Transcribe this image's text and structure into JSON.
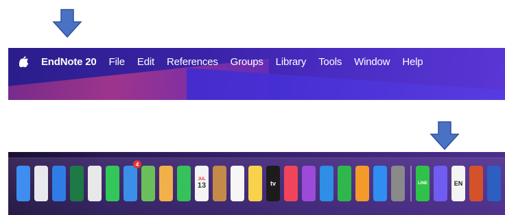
{
  "menubar": {
    "app_name": "EndNote 20",
    "items": [
      "File",
      "Edit",
      "References",
      "Groups",
      "Library",
      "Tools",
      "Window",
      "Help"
    ]
  },
  "dock": {
    "apps": [
      {
        "name": "Finder",
        "icon": "finder-icon",
        "color": "#3d8ef0"
      },
      {
        "name": "Launchpad",
        "icon": "launchpad-icon",
        "color": "#e8e8ee"
      },
      {
        "name": "Safari",
        "icon": "safari-icon",
        "color": "#2f7ce6"
      },
      {
        "name": "Excel",
        "icon": "excel-icon",
        "color": "#1e7a44"
      },
      {
        "name": "Chrome",
        "icon": "chrome-icon",
        "color": "#e8e8e8"
      },
      {
        "name": "Messages",
        "icon": "messages-icon",
        "color": "#33c75a"
      },
      {
        "name": "Mail",
        "icon": "mail-icon",
        "color": "#3b8fe8",
        "badge": "4"
      },
      {
        "name": "Maps",
        "icon": "maps-icon",
        "color": "#6bbf5a"
      },
      {
        "name": "Photos",
        "icon": "photos-icon",
        "color": "#f2b04a"
      },
      {
        "name": "FaceTime",
        "icon": "facetime-icon",
        "color": "#35c25a"
      },
      {
        "name": "Calendar",
        "icon": "calendar-icon",
        "color": "#f4f4f4",
        "month": "JUL",
        "day": "13"
      },
      {
        "name": "Contacts",
        "icon": "contacts-icon",
        "color": "#c48a4a"
      },
      {
        "name": "Reminders",
        "icon": "reminders-icon",
        "color": "#f6f6f6"
      },
      {
        "name": "Notes",
        "icon": "notes-icon",
        "color": "#f7d24a"
      },
      {
        "name": "Apple TV",
        "icon": "appletv-icon",
        "color": "#1c1c1c",
        "label": "tv"
      },
      {
        "name": "Music",
        "icon": "music-icon",
        "color": "#f0445a"
      },
      {
        "name": "Podcasts",
        "icon": "podcasts-icon",
        "color": "#9b4bd8"
      },
      {
        "name": "Keynote",
        "icon": "keynote-icon",
        "color": "#2f8ee6"
      },
      {
        "name": "Numbers",
        "icon": "numbers-icon",
        "color": "#2fb74c"
      },
      {
        "name": "Pages",
        "icon": "pages-icon",
        "color": "#f39a2a"
      },
      {
        "name": "App Store",
        "icon": "appstore-icon",
        "color": "#2f8ef0"
      },
      {
        "name": "System Preferences",
        "icon": "settings-icon",
        "color": "#8a8a8a"
      }
    ],
    "recent": [
      {
        "name": "LINE",
        "icon": "line-icon",
        "color": "#2fc24a",
        "label": "LINE"
      },
      {
        "name": "Messenger",
        "icon": "messenger-icon",
        "color": "#6f5cf0"
      },
      {
        "name": "EndNote",
        "icon": "endnote-icon",
        "color": "#f4f4f4",
        "label": "EN"
      },
      {
        "name": "PowerPoint",
        "icon": "powerpoint-icon",
        "color": "#d4512a"
      },
      {
        "name": "Word",
        "icon": "word-icon",
        "color": "#2c5fc1"
      }
    ],
    "trailing_glyph": "?"
  }
}
